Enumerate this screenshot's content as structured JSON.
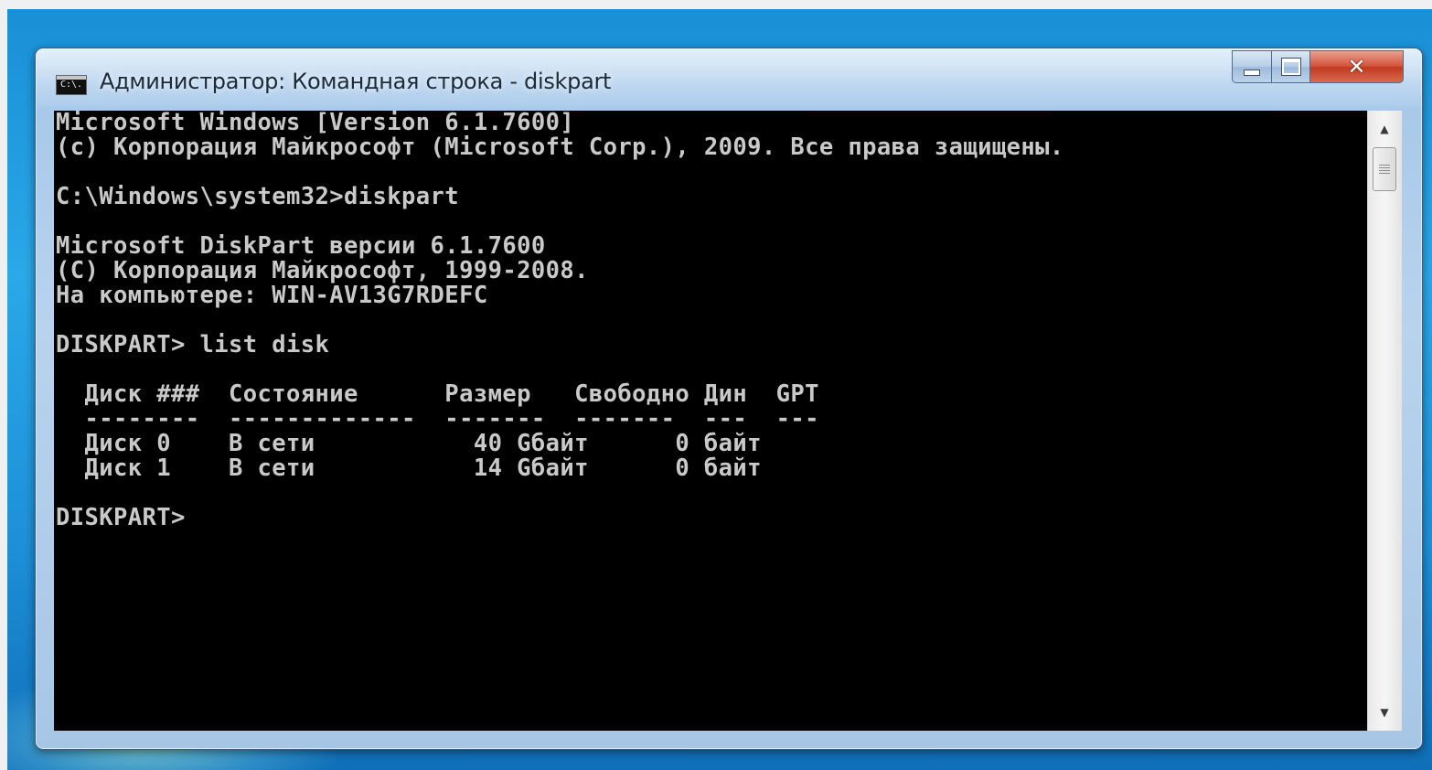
{
  "window": {
    "title": "Администратор: Командная строка - diskpart",
    "icon_label": "C:\\.",
    "controls": {
      "minimize": "minimize-icon",
      "maximize": "maximize-icon",
      "close": "close-icon"
    }
  },
  "console": {
    "lines": [
      "Microsoft Windows [Version 6.1.7600]",
      "(c) Корпорация Майкрософт (Microsoft Corp.), 2009. Все права защищены.",
      "",
      "C:\\Windows\\system32>diskpart",
      "",
      "Microsoft DiskPart версии 6.1.7600",
      "(C) Корпорация Майкрософт, 1999-2008.",
      "На компьютере: WIN-AV13G7RDEFC",
      "",
      "DISKPART> list disk",
      "",
      "  Диск ###  Состояние      Размер   Свободно Дин  GPT",
      "  --------  -------------  -------  -------  ---  ---",
      "  Диск 0    В сети           40 Gбайт      0 байт",
      "  Диск 1    В сети           14 Gбайт      0 байт",
      "",
      "DISKPART>"
    ]
  },
  "colors": {
    "console_bg": "#000000",
    "console_text": "#c9c9c9",
    "close_button": "#c8432b",
    "desktop": "#1e90d8"
  }
}
